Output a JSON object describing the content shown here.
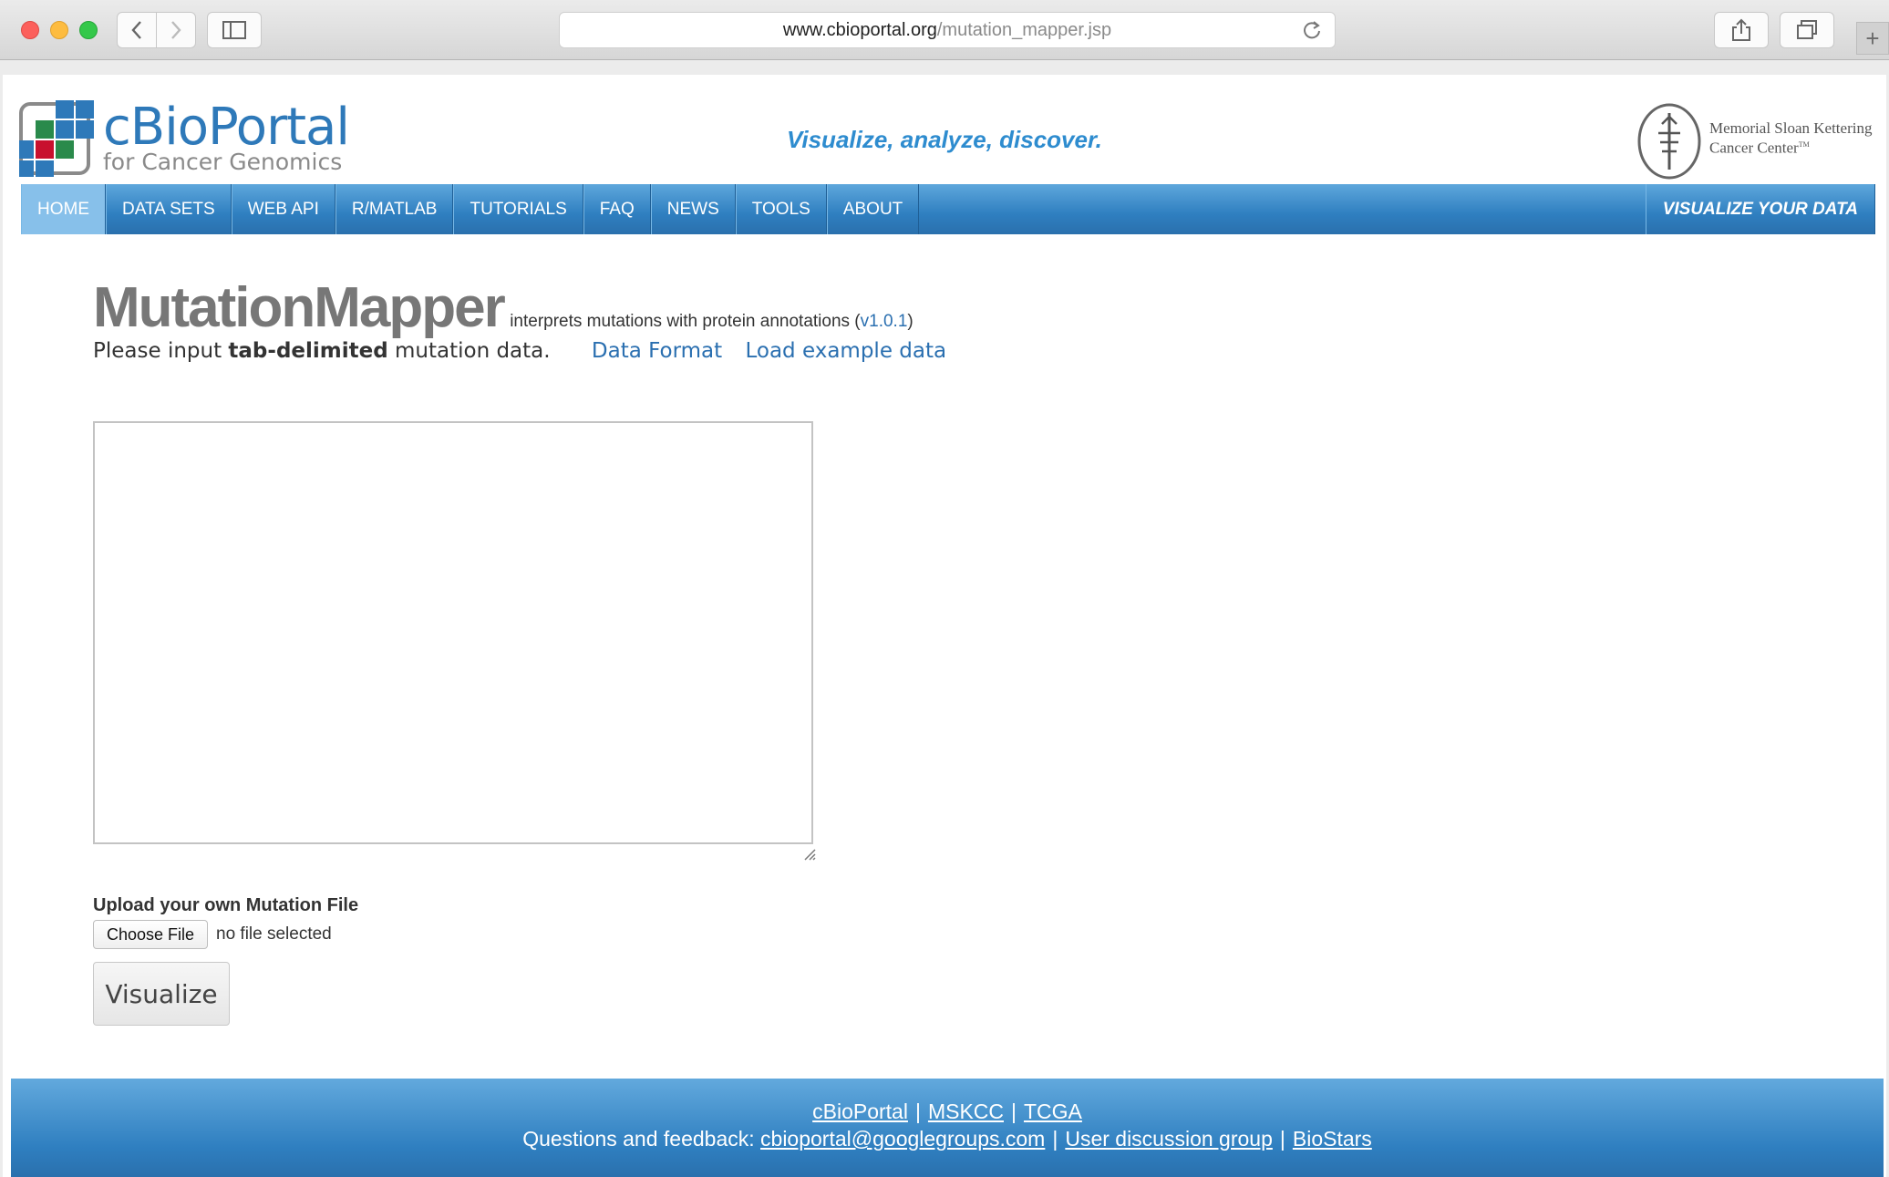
{
  "browser": {
    "url_domain": "www.cbioportal.org",
    "url_path": "/mutation_mapper.jsp"
  },
  "header": {
    "logo_title": "cBioPortal",
    "logo_subtitle": "for Cancer Genomics",
    "tagline": "Visualize, analyze, discover.",
    "partner_line1": "Memorial Sloan Kettering",
    "partner_line2": "Cancer Center",
    "partner_tm": "TM"
  },
  "nav": {
    "items": [
      {
        "label": "HOME"
      },
      {
        "label": "DATA SETS"
      },
      {
        "label": "WEB API"
      },
      {
        "label": "R/MATLAB"
      },
      {
        "label": "TUTORIALS"
      },
      {
        "label": "FAQ"
      },
      {
        "label": "NEWS"
      },
      {
        "label": "TOOLS"
      },
      {
        "label": "ABOUT"
      }
    ],
    "right_label": "VISUALIZE YOUR DATA"
  },
  "main": {
    "title": "MutationMapper",
    "desc_prefix": "interprets mutations with protein annotations (",
    "version": "v1.0.1",
    "desc_suffix": ")",
    "instr_prefix": "Please input ",
    "instr_bold": "tab-delimited",
    "instr_suffix": " mutation data.",
    "link_data_format": "Data Format",
    "link_example": "Load example data",
    "textarea_value": "",
    "upload_label": "Upload your own Mutation File",
    "choose_file": "Choose File",
    "file_status": "no file selected",
    "visualize": "Visualize"
  },
  "footer": {
    "link_cbioportal": "cBioPortal",
    "link_mskcc": "MSKCC",
    "link_tcga": "TCGA",
    "feedback_prefix": "Questions and feedback:",
    "link_email": "cbioportal@googlegroups.com",
    "link_group": "User discussion group",
    "link_biostars": "BioStars",
    "separator": "|"
  },
  "colors": {
    "brand_blue": "#2e79b9",
    "nav_blue": "#2f7fc0",
    "link_blue": "#2a6fb0"
  },
  "icons": [
    "back-icon",
    "forward-icon",
    "sidebar-icon",
    "reload-icon",
    "share-icon",
    "tabs-icon",
    "plus-icon",
    "resize-grip-icon"
  ]
}
